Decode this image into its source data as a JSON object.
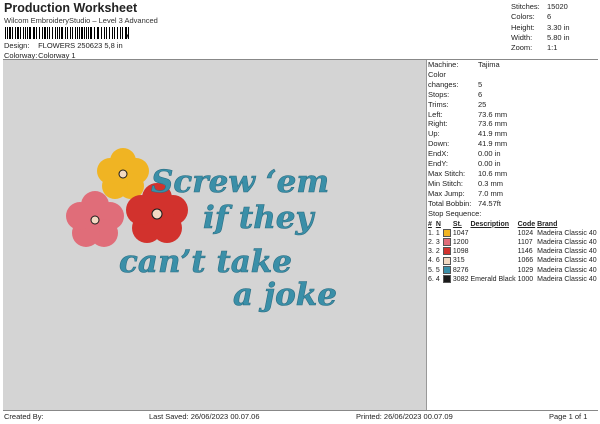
{
  "header": {
    "title": "Production Worksheet",
    "subtitle": "Wilcom EmbroideryStudio – Level 3 Advanced",
    "barcode_suffix": ","
  },
  "design_info": {
    "design_label": "Design:",
    "design_value": "FLOWERS 250623 5,8 in",
    "colorway_label": "Colorway:",
    "colorway_value": "Colorway 1"
  },
  "stats": [
    {
      "label": "Stitches:",
      "value": "15020"
    },
    {
      "label": "Colors:",
      "value": "6"
    },
    {
      "label": "Height:",
      "value": "3.30 in"
    },
    {
      "label": "Width:",
      "value": "5.80 in"
    },
    {
      "label": "Zoom:",
      "value": "1:1"
    }
  ],
  "machine_info": [
    {
      "label": "Machine:",
      "value": "Tajima"
    },
    {
      "label": "Color changes:",
      "value": "5"
    },
    {
      "label": "Stops:",
      "value": "6"
    },
    {
      "label": "Trims:",
      "value": "25"
    },
    {
      "label": "Left:",
      "value": "73.6 mm"
    },
    {
      "label": "Right:",
      "value": "73.6 mm"
    },
    {
      "label": "Up:",
      "value": "41.9 mm"
    },
    {
      "label": "Down:",
      "value": "41.9 mm"
    },
    {
      "label": "EndX:",
      "value": "0.00 in"
    },
    {
      "label": "EndY:",
      "value": "0.00 in"
    },
    {
      "label": "Max Stitch:",
      "value": "10.6 mm"
    },
    {
      "label": "Min Stitch:",
      "value": "0.3 mm"
    },
    {
      "label": "Max Jump:",
      "value": "7.0 mm"
    },
    {
      "label": "Total Bobbin:",
      "value": "74.57ft"
    }
  ],
  "stop_sequence": {
    "label": "Stop Sequence:",
    "columns": [
      "#",
      "N",
      "St.",
      "Description",
      "Code",
      "Brand"
    ],
    "rows": [
      {
        "num": "1.",
        "n": "1",
        "color": "#f0b423",
        "st": "1047",
        "desc": "",
        "code": "1024",
        "brand": "Madeira Classic 40"
      },
      {
        "num": "2.",
        "n": "3",
        "color": "#e06d79",
        "st": "1200",
        "desc": "",
        "code": "1107",
        "brand": "Madeira Classic 40"
      },
      {
        "num": "3.",
        "n": "2",
        "color": "#d2322d",
        "st": "1098",
        "desc": "",
        "code": "1146",
        "brand": "Madeira Classic 40"
      },
      {
        "num": "4.",
        "n": "6",
        "color": "#f3d9c2",
        "st": "315",
        "desc": "",
        "code": "1066",
        "brand": "Madeira Classic 40"
      },
      {
        "num": "5.",
        "n": "5",
        "color": "#3a8fa8",
        "st": "8276",
        "desc": "",
        "code": "1029",
        "brand": "Madeira Classic 40"
      },
      {
        "num": "6.",
        "n": "4",
        "color": "#1a1a1a",
        "st": "3082",
        "desc": "Emerald Black",
        "code": "1000",
        "brand": "Madeira Classic 40"
      }
    ]
  },
  "design_text": {
    "line1": "Screw ‘em",
    "line2": "if they",
    "line3": "can’t take",
    "line4": "a joke"
  },
  "colors": {
    "background": "#d4d4d4",
    "text_thread": "#3a8fa8",
    "yellow": "#f0b423",
    "pink": "#e06d79",
    "red": "#d2322d"
  },
  "footer": {
    "created_by": "Created By:",
    "last_saved": "Last Saved: 26/06/2023 00.07.06",
    "printed": "Printed: 26/06/2023 00.07.09",
    "page": "Page 1 of 1"
  }
}
